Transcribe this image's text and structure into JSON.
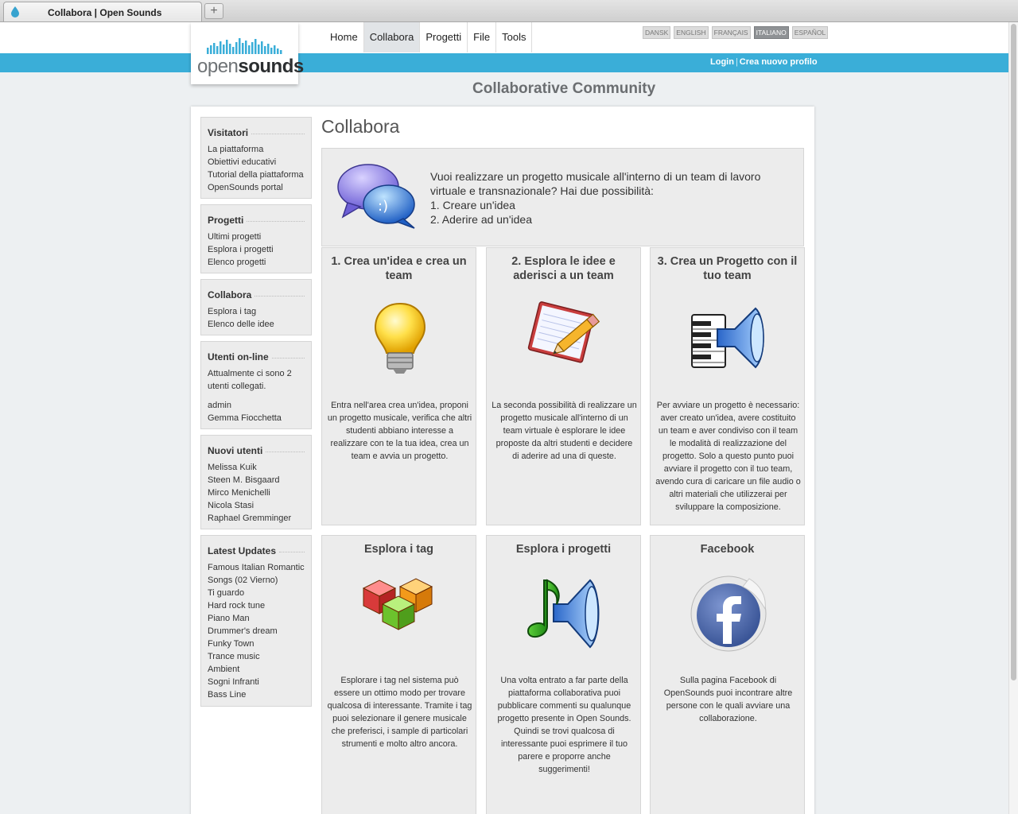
{
  "browser": {
    "tab_title": "Collabora | Open Sounds",
    "new_tab": "+"
  },
  "header": {
    "logo": {
      "open": "open",
      "sounds": "sounds"
    },
    "nav": [
      "Home",
      "Collabora",
      "Progetti",
      "File",
      "Tools"
    ],
    "active_nav": "Collabora",
    "languages": [
      "DANSK",
      "ENGLISH",
      "FRANÇAIS",
      "ITALIANO",
      "ESPAÑOL"
    ],
    "active_language": "ITALIANO",
    "login": "Login",
    "separator": "|",
    "signup": "Crea nuovo profilo",
    "tagline": "Collaborative Community"
  },
  "sidebar": [
    {
      "title": "Visitatori",
      "items": [
        "La piattaforma",
        "Obiettivi educativi",
        "Tutorial della piattaforma",
        "OpenSounds portal"
      ]
    },
    {
      "title": "Progetti",
      "items": [
        "Ultimi progetti",
        "Esplora i progetti",
        "Elenco progetti"
      ]
    },
    {
      "title": "Collabora",
      "items": [
        "Esplora i tag",
        "Elenco delle idee"
      ]
    },
    {
      "title": "Utenti on-line",
      "text_lines": [
        "Attualmente ci sono 2",
        "utenti collegati."
      ],
      "items": [
        "admin",
        "Gemma Fiocchetta"
      ]
    },
    {
      "title": "Nuovi utenti",
      "items": [
        "Melissa Kuik",
        "Steen M. Bisgaard",
        "Mirco Menichelli",
        "Nicola Stasi",
        "Raphael Gremminger"
      ]
    },
    {
      "title": "Latest Updates",
      "items": [
        "Famous Italian Romantic Songs (02 Vierno)",
        "Ti guardo",
        "Hard rock tune",
        "Piano Man",
        "Drummer's dream",
        "Funky Town",
        "Trance music",
        "Ambient",
        "Sogni Infranti",
        "Bass Line"
      ]
    }
  ],
  "content": {
    "title": "Collabora",
    "intro_lines": [
      "Vuoi realizzare un progetto musicale all'interno di un team di lavoro",
      "virtuale e transnazionale? Hai due possibilità:",
      "1. Creare un'idea",
      "2. Aderire ad un'idea"
    ],
    "cards": [
      {
        "title": "1. Crea un'idea e crea un team",
        "icon": "lightbulb-icon",
        "desc": "Entra nell'area crea un'idea, proponi un progetto musicale, verifica che altri studenti abbiano interesse a realizzare con te la tua idea, crea un team e avvia un progetto."
      },
      {
        "title": "2. Esplora le idee e aderisci a un team",
        "icon": "notepad-pencil-icon",
        "desc": "La seconda possibilità di realizzare un progetto musicale all'interno di un team virtuale è esplorare le idee proposte da altri studenti e decidere di aderire ad una di queste."
      },
      {
        "title": "3. Crea un Progetto con il tuo team",
        "icon": "piano-speaker-icon",
        "desc": "Per avviare un progetto è necessario: aver creato un'idea, avere costituito un team e aver condiviso con il team le modalità di realizzazione del progetto. Solo a questo punto puoi avviare il progetto con il tuo team, avendo cura di caricare un file audio o altri materiali che utilizzerai per sviluppare la composizione."
      },
      {
        "title": "Esplora i tag",
        "icon": "cubes-icon",
        "desc": "Esplorare i tag nel sistema può essere un ottimo modo per trovare qualcosa di interessante. Tramite i tag puoi selezionare il genere musicale che preferisci, i sample di particolari strumenti e molto altro ancora."
      },
      {
        "title": "Esplora i progetti",
        "icon": "music-note-speaker-icon",
        "desc": "Una volta entrato a far parte della piattaforma collaborativa puoi pubblicare commenti su qualunque progetto presente in Open Sounds. Quindi se trovi qualcosa di interessante puoi esprimere il tuo parere e proporre anche suggerimenti!"
      },
      {
        "title": "Facebook",
        "icon": "facebook-icon",
        "desc": "Sulla pagina Facebook di OpenSounds puoi incontrare altre persone con le quali avviare una collaborazione."
      }
    ]
  },
  "colors": {
    "accent_bar": "#3aaed8",
    "page_bg": "#edf0f2",
    "box_bg": "#ececec"
  }
}
